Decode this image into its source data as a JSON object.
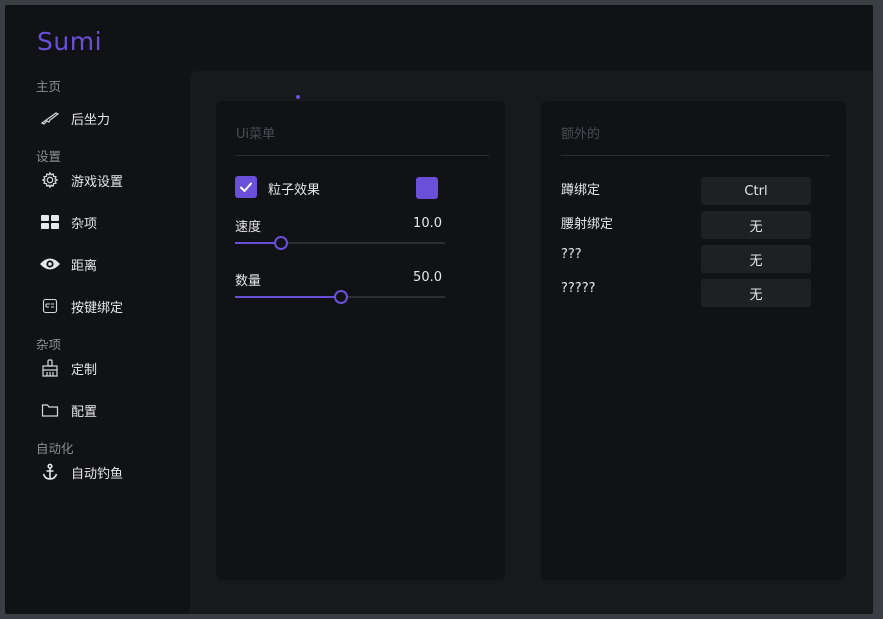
{
  "app": {
    "title": "Sumi",
    "accent_color": "#6a4fd9"
  },
  "sidebar": {
    "sections": [
      {
        "label": "主页",
        "items": [
          {
            "label": "后坐力",
            "icon": "rifle-icon"
          }
        ]
      },
      {
        "label": "设置",
        "items": [
          {
            "label": "游戏设置",
            "icon": "gear-icon"
          },
          {
            "label": "杂项",
            "icon": "grid-icon"
          },
          {
            "label": "距离",
            "icon": "eye-icon"
          },
          {
            "label": "按键绑定",
            "icon": "key-icon"
          }
        ]
      },
      {
        "label": "杂项",
        "items": [
          {
            "label": "定制",
            "icon": "brush-icon"
          },
          {
            "label": "配置",
            "icon": "folder-icon"
          }
        ]
      },
      {
        "label": "自动化",
        "items": [
          {
            "label": "自动钓鱼",
            "icon": "anchor-icon"
          }
        ]
      }
    ]
  },
  "ui_menu": {
    "title": "Ui菜单",
    "particle_effect": {
      "label": "粒子效果",
      "checked": true,
      "color": "#6a4fd9"
    },
    "sliders": [
      {
        "label": "速度",
        "value": "10.0",
        "fraction": 0.22
      },
      {
        "label": "数量",
        "value": "50.0",
        "fraction": 0.505
      }
    ]
  },
  "extra": {
    "title": "额外的",
    "bindings": [
      {
        "label": "蹲绑定",
        "value": "Ctrl"
      },
      {
        "label": "腰射绑定",
        "value": "无"
      },
      {
        "label": "???",
        "value": "无"
      },
      {
        "label": "?????",
        "value": "无"
      }
    ]
  }
}
